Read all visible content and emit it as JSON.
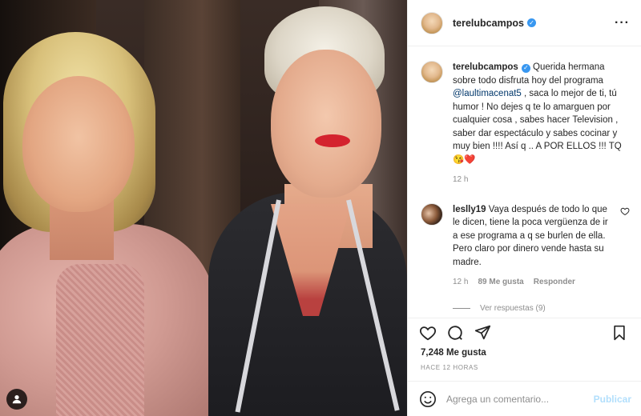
{
  "post": {
    "author": "terelubcampos",
    "photo_icon": "user-tag-icon"
  },
  "caption": {
    "username": "terelubcampos",
    "text_before": "Querida hermana sobre todo disfruta hoy del programa ",
    "mention": "@laultimacenat5",
    "text_after": " , saca lo mejor de ti, tú humor ! No dejes q te lo amarguen por cualquier cosa , sabes hacer Television , saber dar espectáculo y sabes cocinar y muy bien !!!! Así q .. A POR ELLOS !!! TQ 😘❤️",
    "time": "12 h"
  },
  "comment": {
    "username": "leslly19",
    "text": "Vaya después de todo lo que le dicen, tiene la poca vergüenza de ir a ese programa a q se burlen de ella. Pero claro por dinero vende hasta su madre.",
    "time": "12 h",
    "likes": "89 Me gusta",
    "reply_label": "Responder"
  },
  "view_replies": "Ver respuestas (9)",
  "likes_count": "7,248 Me gusta",
  "time_ago": "HACE 12 HORAS",
  "add_comment": {
    "placeholder": "Agrega un comentario...",
    "publish_label": "Publicar"
  },
  "colors": {
    "verified": "#3897f0",
    "publish_disabled": "#b2dffc",
    "heart": "#d4232e"
  }
}
